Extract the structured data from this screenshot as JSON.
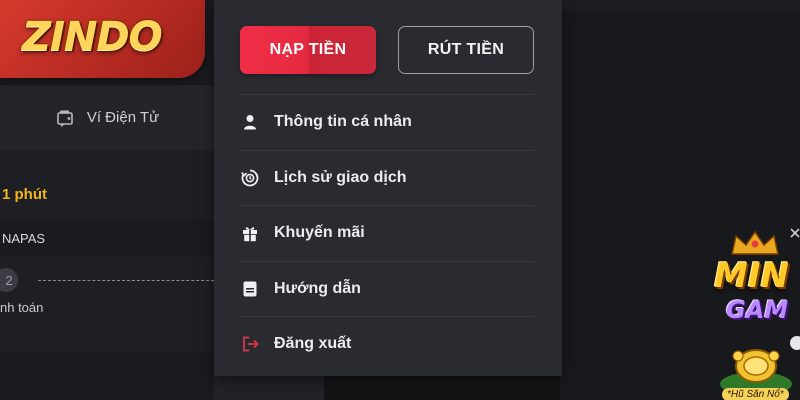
{
  "brand": {
    "logo_text": "ZINDO"
  },
  "left_panel": {
    "wallet_label": "Ví Điện Tử",
    "time_text": "1 phút",
    "napas_text": "NAPAS",
    "step_number": "2",
    "step_label": "nh toán"
  },
  "menu": {
    "deposit_label": "NẠP TIỀN",
    "withdraw_label": "RÚT TIỀN",
    "items": [
      {
        "label": "Thông tin cá nhân",
        "icon": "user-icon"
      },
      {
        "label": "Lịch sử giao dịch",
        "icon": "history-icon"
      },
      {
        "label": "Khuyến mãi",
        "icon": "gift-icon"
      },
      {
        "label": "Hướng dẫn",
        "icon": "guide-icon"
      },
      {
        "label": "Đăng xuất",
        "icon": "logout-icon"
      }
    ]
  },
  "game_promo": {
    "title_top": "MIN",
    "title_bottom": "GAM",
    "badge_text": "*Hũ Săn Nổ*"
  },
  "colors": {
    "accent_red": "#e42a40",
    "logo_gold": "#ffd45a",
    "time_yellow": "#f1b51c",
    "menu_bg": "#2a2b31",
    "logout_icon": "#e0394a"
  }
}
